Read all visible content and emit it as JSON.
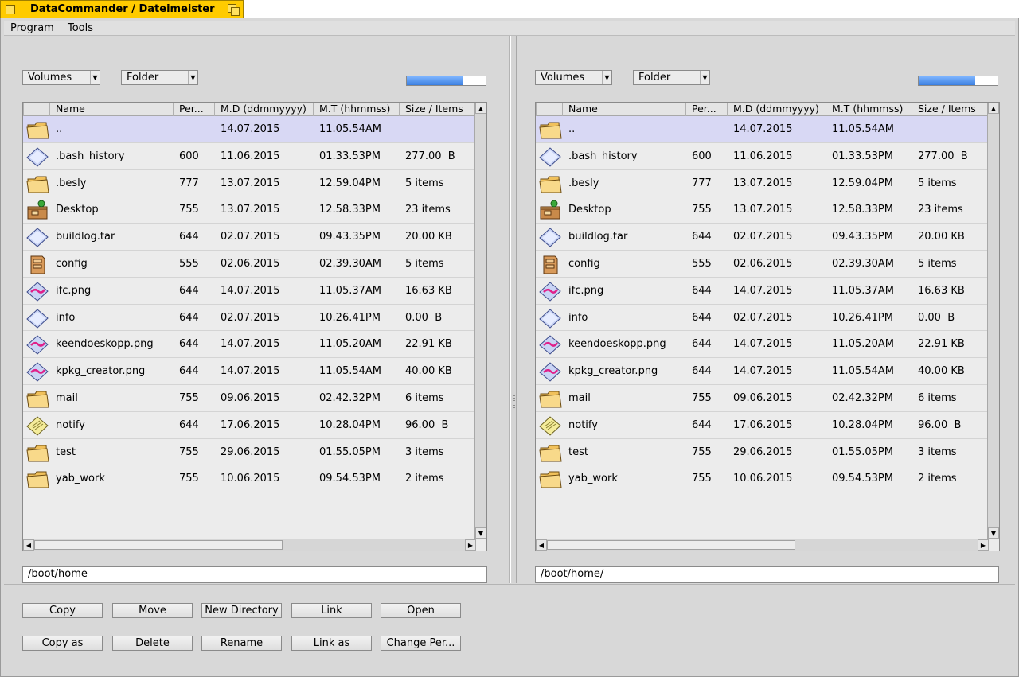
{
  "window": {
    "title": "DataCommander / Dateimeister"
  },
  "menu": {
    "items": [
      "Program",
      "Tools"
    ]
  },
  "columns": [
    "Name",
    "Per...",
    "M.D (ddmmyyyy)",
    "M.T (hhmmss)",
    "Size / Items"
  ],
  "panels": [
    {
      "volumes_label": "Volumes",
      "folder_label": "Folder",
      "usage_fraction": 0.72,
      "path": "/boot/home",
      "files": [
        {
          "icon": "folder-icon",
          "name": "..",
          "perm": "",
          "date": "14.07.2015",
          "time": "11.05.54AM",
          "size": ""
        },
        {
          "icon": "file-icon",
          "name": ".bash_history",
          "perm": "600",
          "date": "11.06.2015",
          "time": "01.33.53PM",
          "size": "277.00  B"
        },
        {
          "icon": "folder-icon",
          "name": ".besly",
          "perm": "777",
          "date": "13.07.2015",
          "time": "12.59.04PM",
          "size": "5 items"
        },
        {
          "icon": "desktop-icon",
          "name": "Desktop",
          "perm": "755",
          "date": "13.07.2015",
          "time": "12.58.33PM",
          "size": "23 items"
        },
        {
          "icon": "file-icon",
          "name": "buildlog.tar",
          "perm": "644",
          "date": "02.07.2015",
          "time": "09.43.35PM",
          "size": "20.00 KB"
        },
        {
          "icon": "config-icon",
          "name": "config",
          "perm": "555",
          "date": "02.06.2015",
          "time": "02.39.30AM",
          "size": "5 items"
        },
        {
          "icon": "image-icon",
          "name": "ifc.png",
          "perm": "644",
          "date": "14.07.2015",
          "time": "11.05.37AM",
          "size": "16.63 KB"
        },
        {
          "icon": "file-icon",
          "name": "info",
          "perm": "644",
          "date": "02.07.2015",
          "time": "10.26.41PM",
          "size": "0.00  B"
        },
        {
          "icon": "image-icon",
          "name": "keendoeskopp.png",
          "perm": "644",
          "date": "14.07.2015",
          "time": "11.05.20AM",
          "size": "22.91 KB"
        },
        {
          "icon": "image-icon",
          "name": "kpkg_creator.png",
          "perm": "644",
          "date": "14.07.2015",
          "time": "11.05.54AM",
          "size": "40.00 KB"
        },
        {
          "icon": "folder-icon",
          "name": "mail",
          "perm": "755",
          "date": "09.06.2015",
          "time": "02.42.32PM",
          "size": "6 items"
        },
        {
          "icon": "text-icon",
          "name": "notify",
          "perm": "644",
          "date": "17.06.2015",
          "time": "10.28.04PM",
          "size": "96.00  B"
        },
        {
          "icon": "folder-icon",
          "name": "test",
          "perm": "755",
          "date": "29.06.2015",
          "time": "01.55.05PM",
          "size": "3 items"
        },
        {
          "icon": "folder-icon",
          "name": "yab_work",
          "perm": "755",
          "date": "10.06.2015",
          "time": "09.54.53PM",
          "size": "2 items"
        }
      ]
    },
    {
      "volumes_label": "Volumes",
      "folder_label": "Folder",
      "usage_fraction": 0.72,
      "path": "/boot/home/",
      "files": [
        {
          "icon": "folder-icon",
          "name": "..",
          "perm": "",
          "date": "14.07.2015",
          "time": "11.05.54AM",
          "size": ""
        },
        {
          "icon": "file-icon",
          "name": ".bash_history",
          "perm": "600",
          "date": "11.06.2015",
          "time": "01.33.53PM",
          "size": "277.00  B"
        },
        {
          "icon": "folder-icon",
          "name": ".besly",
          "perm": "777",
          "date": "13.07.2015",
          "time": "12.59.04PM",
          "size": "5 items"
        },
        {
          "icon": "desktop-icon",
          "name": "Desktop",
          "perm": "755",
          "date": "13.07.2015",
          "time": "12.58.33PM",
          "size": "23 items"
        },
        {
          "icon": "file-icon",
          "name": "buildlog.tar",
          "perm": "644",
          "date": "02.07.2015",
          "time": "09.43.35PM",
          "size": "20.00 KB"
        },
        {
          "icon": "config-icon",
          "name": "config",
          "perm": "555",
          "date": "02.06.2015",
          "time": "02.39.30AM",
          "size": "5 items"
        },
        {
          "icon": "image-icon",
          "name": "ifc.png",
          "perm": "644",
          "date": "14.07.2015",
          "time": "11.05.37AM",
          "size": "16.63 KB"
        },
        {
          "icon": "file-icon",
          "name": "info",
          "perm": "644",
          "date": "02.07.2015",
          "time": "10.26.41PM",
          "size": "0.00  B"
        },
        {
          "icon": "image-icon",
          "name": "keendoeskopp.png",
          "perm": "644",
          "date": "14.07.2015",
          "time": "11.05.20AM",
          "size": "22.91 KB"
        },
        {
          "icon": "image-icon",
          "name": "kpkg_creator.png",
          "perm": "644",
          "date": "14.07.2015",
          "time": "11.05.54AM",
          "size": "40.00 KB"
        },
        {
          "icon": "folder-icon",
          "name": "mail",
          "perm": "755",
          "date": "09.06.2015",
          "time": "02.42.32PM",
          "size": "6 items"
        },
        {
          "icon": "text-icon",
          "name": "notify",
          "perm": "644",
          "date": "17.06.2015",
          "time": "10.28.04PM",
          "size": "96.00  B"
        },
        {
          "icon": "folder-icon",
          "name": "test",
          "perm": "755",
          "date": "29.06.2015",
          "time": "01.55.05PM",
          "size": "3 items"
        },
        {
          "icon": "folder-icon",
          "name": "yab_work",
          "perm": "755",
          "date": "10.06.2015",
          "time": "09.54.53PM",
          "size": "2 items"
        }
      ]
    }
  ],
  "buttons": {
    "copy": "Copy",
    "move": "Move",
    "new_directory": "New Directory",
    "link": "Link",
    "open": "Open",
    "copy_as": "Copy as",
    "delete": "Delete",
    "rename": "Rename",
    "link_as": "Link as",
    "change_perm": "Change Per..."
  },
  "colors": {
    "tab_yellow": "#ffcb00",
    "selected_row": "#d8d8f4",
    "progress_blue": "#3a7fe0"
  }
}
